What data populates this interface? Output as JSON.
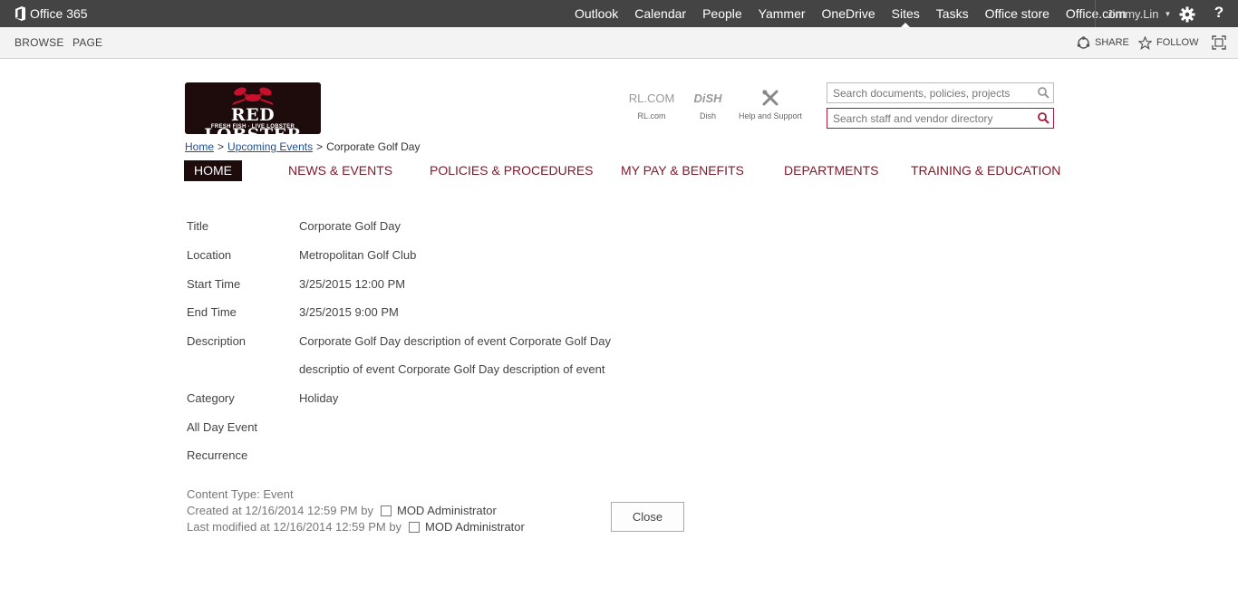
{
  "suite": {
    "brand": "Office 365",
    "nav": [
      "Outlook",
      "Calendar",
      "People",
      "Yammer",
      "OneDrive",
      "Sites",
      "Tasks",
      "Office store",
      "Office.com"
    ],
    "active_nav": "Sites",
    "user": "Jimmy.Lin",
    "help": "?"
  },
  "ribbon": {
    "tabs": [
      "BROWSE",
      "PAGE"
    ],
    "share_label": "SHARE",
    "follow_label": "FOLLOW"
  },
  "header": {
    "logo_text": "RED LOBSTER",
    "logo_tagline": "FRESH FISH · LIVE LOBSTER",
    "quicklinks": [
      {
        "icon_text": "RL.COM",
        "label": "RL.com"
      },
      {
        "icon_text": "DiSH",
        "label": "Dish"
      },
      {
        "icon": "tools-icon",
        "label": "Help and Support"
      }
    ],
    "search_docs_placeholder": "Search documents, policies, projects",
    "search_staff_placeholder": "Search staff and vendor directory"
  },
  "breadcrumb": {
    "home": "Home",
    "sep": ">",
    "parent": "Upcoming Events",
    "current": "Corporate Golf Day"
  },
  "mainnav": [
    "HOME",
    "NEWS & EVENTS",
    "POLICIES & PROCEDURES",
    "MY PAY & BENEFITS",
    "DEPARTMENTS",
    "TRAINING & EDUCATION"
  ],
  "fields": [
    {
      "label": "Title",
      "value": "Corporate Golf Day"
    },
    {
      "label": "Location",
      "value": "Metropolitan Golf Club"
    },
    {
      "label": "Start Time",
      "value": "3/25/2015 12:00 PM"
    },
    {
      "label": "End Time",
      "value": "3/25/2015 9:00 PM"
    },
    {
      "label": "Description",
      "value": "Corporate Golf Day description of event Corporate Golf Day",
      "value2": "descriptio of event Corporate Golf Day description of event"
    },
    {
      "label": "Category",
      "value": "Holiday"
    },
    {
      "label": "All Day Event",
      "value": ""
    },
    {
      "label": "Recurrence",
      "value": ""
    }
  ],
  "footer": {
    "content_type": "Content Type: Event",
    "created": "Created at 12/16/2014 12:59 PM by",
    "created_by": "MOD Administrator",
    "modified": "Last modified at 12/16/2014 12:59 PM by",
    "modified_by": "MOD Administrator",
    "close_label": "Close"
  },
  "colors": {
    "suitebar": "#444444",
    "brand_maroon": "#7a1a2a",
    "logo_bg": "#1e0b0c",
    "link_blue": "#1d4f9b"
  }
}
